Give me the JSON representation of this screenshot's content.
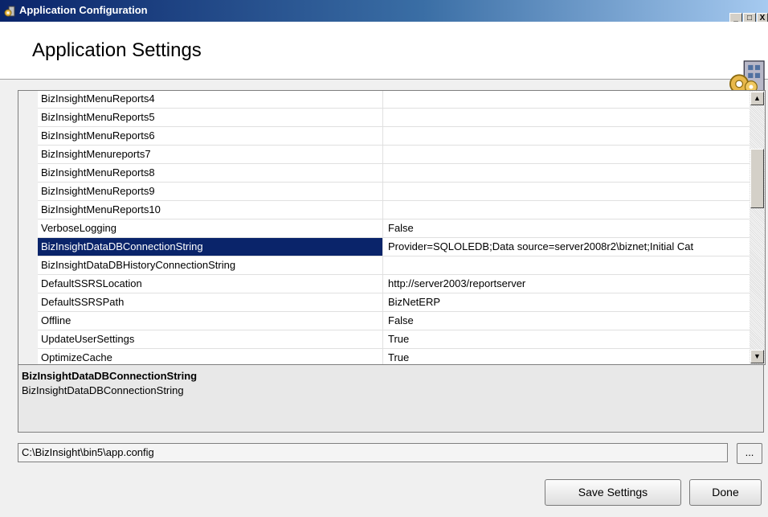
{
  "window": {
    "title": "Application Configuration",
    "controls": {
      "minimize": "_",
      "maximize": "□",
      "close": "X"
    }
  },
  "header": {
    "title": "Application Settings"
  },
  "settings_grid": {
    "rows": [
      {
        "key": "BizInsightMenuReports4",
        "value": ""
      },
      {
        "key": "BizInsightMenuReports5",
        "value": ""
      },
      {
        "key": "BizInsightMenuReports6",
        "value": ""
      },
      {
        "key": "BizInsightMenureports7",
        "value": ""
      },
      {
        "key": "BizInsightMenuReports8",
        "value": ""
      },
      {
        "key": "BizInsightMenuReports9",
        "value": ""
      },
      {
        "key": "BizInsightMenuReports10",
        "value": ""
      },
      {
        "key": "VerboseLogging",
        "value": "False"
      },
      {
        "key": "BizInsightDataDBConnectionString",
        "value": "Provider=SQLOLEDB;Data source=server2008r2\\biznet;Initial Cat"
      },
      {
        "key": "BizInsightDataDBHistoryConnectionString",
        "value": ""
      },
      {
        "key": "DefaultSSRSLocation",
        "value": "http://server2003/reportserver"
      },
      {
        "key": "DefaultSSRSPath",
        "value": "BizNetERP"
      },
      {
        "key": "Offline",
        "value": "False"
      },
      {
        "key": "UpdateUserSettings",
        "value": "True"
      },
      {
        "key": "OptimizeCache",
        "value": "True"
      }
    ],
    "selected_index": 8
  },
  "description": {
    "title": "BizInsightDataDBConnectionString",
    "text": "BizInsightDataDBConnectionString"
  },
  "config_path": {
    "value": "C:\\BizInsight\\bin5\\app.config",
    "browse_label": "..."
  },
  "buttons": {
    "save": "Save Settings",
    "done": "Done"
  },
  "icons": {
    "app": "gear-building-icon",
    "header": "gear-building-icon"
  },
  "colors": {
    "selection": "#0a246a",
    "titlebar": "#0a246a"
  }
}
